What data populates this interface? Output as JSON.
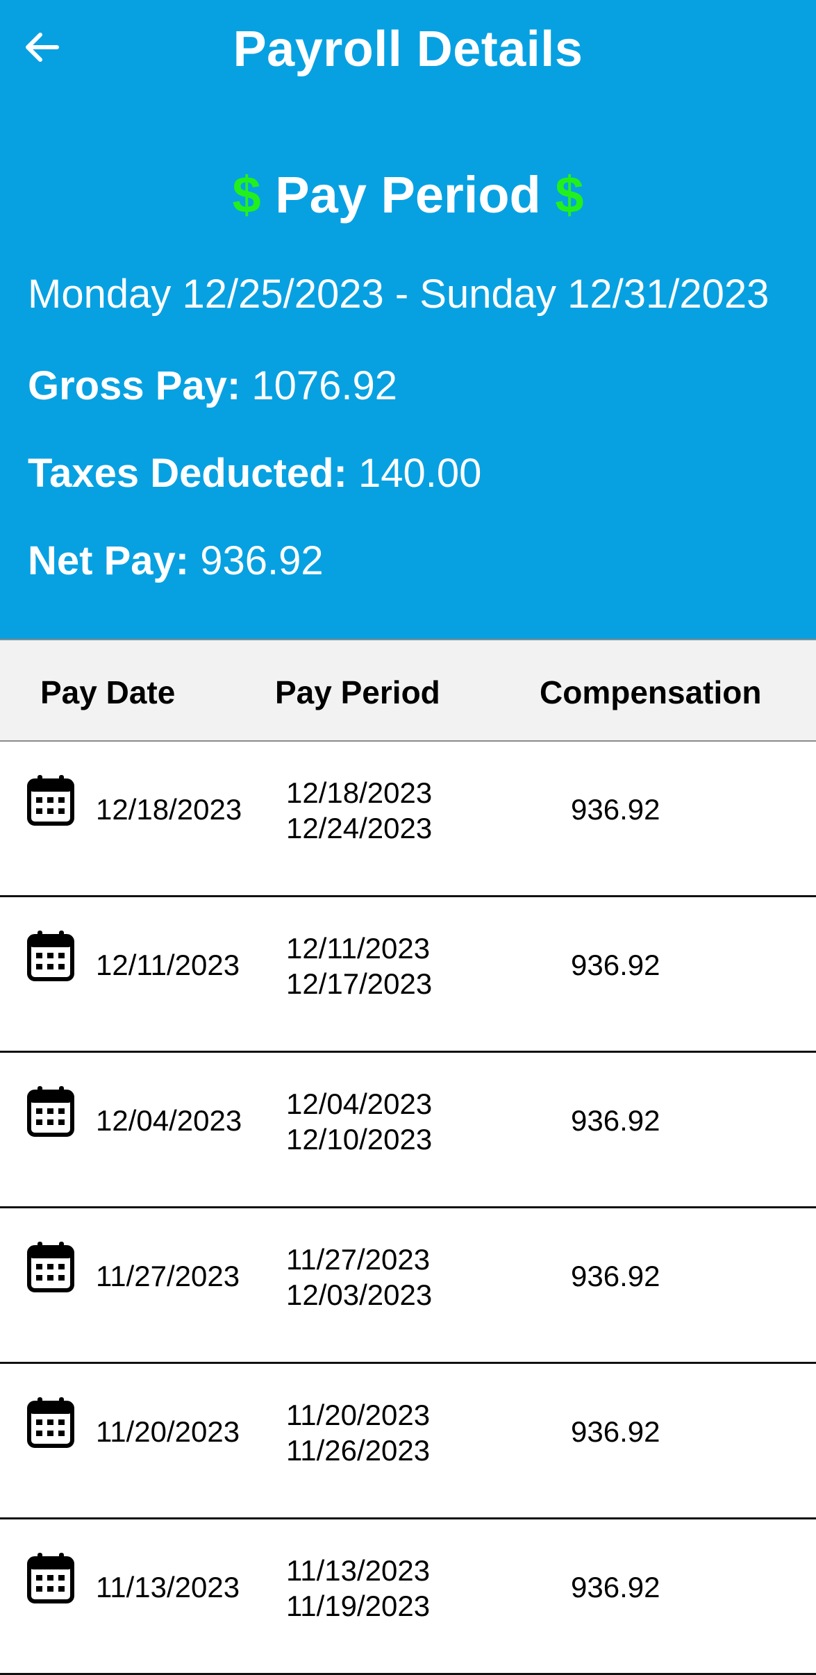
{
  "header": {
    "title": "Payroll Details",
    "back_icon": "arrow-left-icon",
    "period_heading": "Pay Period",
    "dollar_symbol": "$",
    "date_range": "Monday 12/25/2023 - Sunday 12/31/2023",
    "gross_label": "Gross Pay:",
    "gross_value": "1076.92",
    "taxes_label": "Taxes Deducted:",
    "taxes_value": "140.00",
    "net_label": "Net Pay:",
    "net_value": "936.92"
  },
  "colors": {
    "header_bg": "#07a1e2",
    "dollar": "#22f01c",
    "table_header_bg": "#f2f2f2"
  },
  "table": {
    "columns": [
      "Pay Date",
      "Pay Period",
      "Compensation"
    ],
    "row_icon": "calendar-icon",
    "rows": [
      {
        "pay_date": "12/18/2023",
        "period_start": "12/18/2023",
        "period_end": "12/24/2023",
        "compensation": "936.92"
      },
      {
        "pay_date": "12/11/2023",
        "period_start": "12/11/2023",
        "period_end": "12/17/2023",
        "compensation": "936.92"
      },
      {
        "pay_date": "12/04/2023",
        "period_start": "12/04/2023",
        "period_end": "12/10/2023",
        "compensation": "936.92"
      },
      {
        "pay_date": "11/27/2023",
        "period_start": "11/27/2023",
        "period_end": "12/03/2023",
        "compensation": "936.92"
      },
      {
        "pay_date": "11/20/2023",
        "period_start": "11/20/2023",
        "period_end": "11/26/2023",
        "compensation": "936.92"
      },
      {
        "pay_date": "11/13/2023",
        "period_start": "11/13/2023",
        "period_end": "11/19/2023",
        "compensation": "936.92"
      }
    ]
  }
}
